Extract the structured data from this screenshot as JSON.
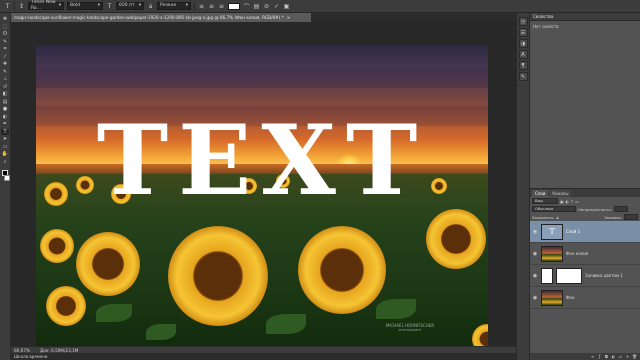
{
  "options_bar": {
    "font_family": "Times New Ro...",
    "font_style": "Bold",
    "font_size": "600 пт",
    "anti_alias": "Резкое",
    "swatch_color": "#ffffff"
  },
  "document_tab": {
    "title": "magic-landscape-sunflower-magic-landscape-garden-wallpaper-1920-x-1200-895 kb-jpeg-x.jpg @ 66,7% (Фон копия, RGB/8#) *",
    "close": "×"
  },
  "canvas": {
    "headline": "TEXT",
    "watermark_line1": "MICHAEL HORNFISCHER",
    "watermark_line2": "PHOTOGRAPHY"
  },
  "status_bar": {
    "zoom": "66,67%",
    "doc_info": "Док: 6,59M/23,1M"
  },
  "timeline_tab": {
    "label": "Шкала времени"
  },
  "properties_panel": {
    "title": "Свойства",
    "subtitle": "Нет свойств"
  },
  "layers_panel": {
    "tabs": [
      "Слои",
      "Каналы"
    ],
    "kind_filter": "Вид",
    "blend_mode": "Обычные",
    "opacity_label": "Непрозрачность:",
    "lock_label": "Закрепить:",
    "fill_label": "Заливка:",
    "layers": [
      {
        "name": "Слой 1",
        "thumb": "text",
        "thumb_glyph": "T",
        "selected": true
      },
      {
        "name": "Фон копия",
        "thumb": "image",
        "selected": false
      },
      {
        "name": "Заливка цветом 1",
        "thumb": "white",
        "selected": false
      },
      {
        "name": "Фон",
        "thumb": "image",
        "selected": false
      }
    ]
  },
  "colors": {
    "ui_dark": "#3c3c3c",
    "ui_mid": "#535353",
    "selection": "#7a8fa8"
  }
}
